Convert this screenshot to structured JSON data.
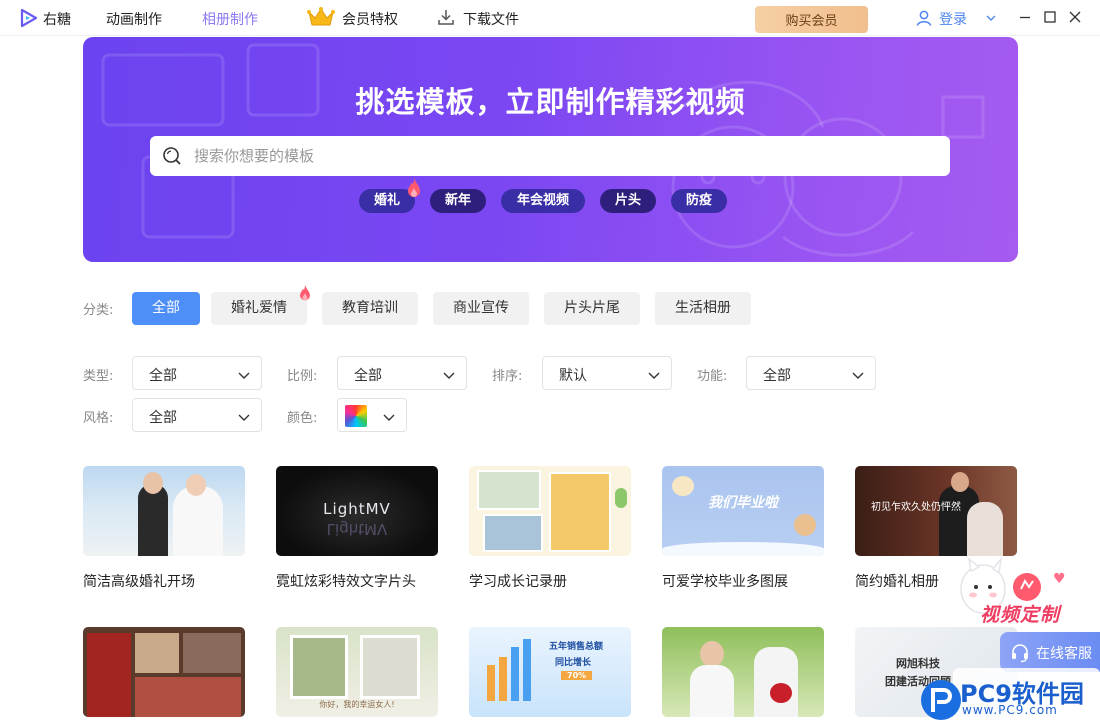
{
  "app": {
    "brand": "右糖"
  },
  "nav": {
    "animation": "动画制作",
    "album": "相册制作",
    "vip": "会员特权",
    "download": "下载文件"
  },
  "header": {
    "buy_vip": "购买会员",
    "login": "登录"
  },
  "banner": {
    "title": "挑选模板，立即制作精彩视频",
    "search_placeholder": "搜索你想要的模板",
    "tags": [
      "婚礼",
      "新年",
      "年会视频",
      "片头",
      "防疫"
    ]
  },
  "categories": {
    "label": "分类:",
    "items": [
      "全部",
      "婚礼爱情",
      "教育培训",
      "商业宣传",
      "片头片尾",
      "生活相册"
    ],
    "active": "全部"
  },
  "filters": {
    "type": {
      "label": "类型:",
      "value": "全部"
    },
    "ratio": {
      "label": "比例:",
      "value": "全部"
    },
    "sort": {
      "label": "排序:",
      "value": "默认"
    },
    "feature": {
      "label": "功能:",
      "value": "全部"
    },
    "style": {
      "label": "风格:",
      "value": "全部"
    },
    "color": {
      "label": "颜色:"
    }
  },
  "templates": [
    {
      "title": "简洁高级婚礼开场"
    },
    {
      "title": "霓虹炫彩特效文字片头",
      "thumb_text": "LightMV"
    },
    {
      "title": "学习成长记录册"
    },
    {
      "title": "可爱学校毕业多图展",
      "thumb_text": "我们毕业啦"
    },
    {
      "title": "简约婚礼相册",
      "thumb_text": "初见乍欢久处仍怦然"
    },
    {
      "title": ""
    },
    {
      "title": "",
      "thumb_text": "你好，我的幸运女人!"
    },
    {
      "title": "",
      "thumb_text": "五年销售总额",
      "thumb_sub": "同比增长",
      "thumb_badge": "70%"
    },
    {
      "title": ""
    },
    {
      "title": "",
      "thumb_text": "网旭科技",
      "thumb_sub": "团建活动回顾"
    }
  ],
  "side": {
    "custom": "视频定制",
    "service": "在线客服"
  },
  "watermark": {
    "text": "PC9软件园",
    "url": "www.PC9.com"
  },
  "colors": {
    "accent": "#4d8ef7",
    "banner": "#7b47f2",
    "vip_gold": "#f1bf8e",
    "album_active": "#8e7af0"
  }
}
